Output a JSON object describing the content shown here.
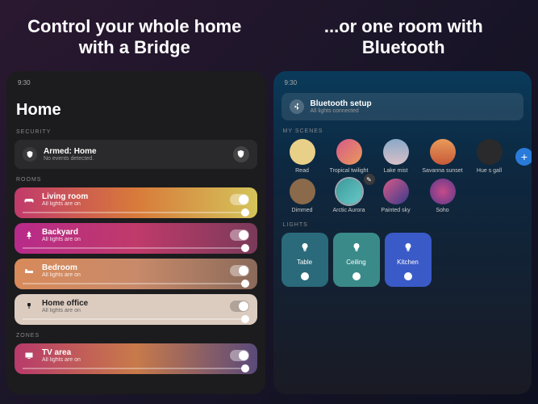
{
  "headlines": {
    "left": "Control your whole home with a Bridge",
    "right": "...or one room with Bluetooth"
  },
  "leftScreen": {
    "time": "9:30",
    "title": "Home",
    "sections": {
      "security": "SECURITY",
      "rooms": "ROOMS",
      "zones": "ZONES"
    },
    "security": {
      "title": "Armed: Home",
      "sub": "No events detected."
    },
    "rooms": [
      {
        "name": "Living room",
        "sub": "All lights are on",
        "class": "g-living",
        "icon": "couch"
      },
      {
        "name": "Backyard",
        "sub": "All lights are on",
        "class": "g-backyard",
        "icon": "tree"
      },
      {
        "name": "Bedroom",
        "sub": "All lights are on",
        "class": "g-bedroom",
        "icon": "bed"
      },
      {
        "name": "Home office",
        "sub": "All lights are on",
        "class": "g-office",
        "icon": "chair"
      },
      {
        "name": "TV area",
        "sub": "All lights are on",
        "class": "g-tv",
        "icon": "tv"
      }
    ]
  },
  "rightScreen": {
    "time": "9:30",
    "bluetooth": {
      "title": "Bluetooth setup",
      "sub": "All lights connected"
    },
    "sections": {
      "scenes": "MY SCENES",
      "lights": "LIGHTS"
    },
    "scenesRow1": [
      {
        "name": "Read",
        "color": "#e8d088"
      },
      {
        "name": "Tropical twilight",
        "color": "linear-gradient(135deg,#d85a8a,#e89a5a)"
      },
      {
        "name": "Lake mist",
        "color": "linear-gradient(180deg,#8aa8c8,#d8c0c8)"
      },
      {
        "name": "Savanna sunset",
        "color": "linear-gradient(180deg,#e89a5a,#c85a3a)"
      },
      {
        "name": "Hue s gall",
        "color": "#2a2a2c"
      }
    ],
    "scenesRow2": [
      {
        "name": "Dimmed",
        "color": "#8a6a4a"
      },
      {
        "name": "Arctic Aurora",
        "color": "linear-gradient(135deg,#3a9a9a,#6ac8c8)",
        "active": true,
        "edit": true
      },
      {
        "name": "Painted sky",
        "color": "linear-gradient(135deg,#d85a8a,#3a3a8a)"
      },
      {
        "name": "Soho",
        "color": "radial-gradient(circle,#c84a8a,#5a3a8a)"
      }
    ],
    "lights": [
      {
        "name": "Table",
        "bg": "#2a6a7a",
        "icon": "#fff"
      },
      {
        "name": "Ceiling",
        "bg": "#3a8a8a",
        "icon": "#fff"
      },
      {
        "name": "Kitchen",
        "bg": "#3a5ac8",
        "icon": "#fff"
      }
    ]
  }
}
